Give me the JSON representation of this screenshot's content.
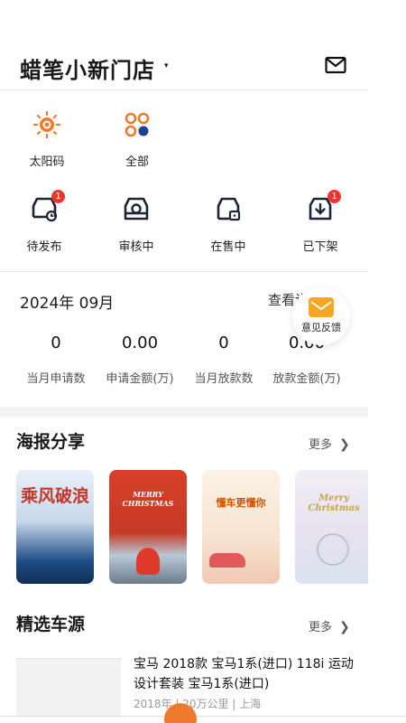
{
  "header": {
    "store_name": "蜡笔小新门店",
    "caret": "▾"
  },
  "quick_actions": [
    {
      "label": "太阳码",
      "icon": "sun-code-icon"
    },
    {
      "label": "全部",
      "icon": "grid-all-icon"
    }
  ],
  "status_items": [
    {
      "label": "待发布",
      "icon": "car-pending-icon",
      "badge": "1"
    },
    {
      "label": "审核中",
      "icon": "car-review-icon",
      "badge": ""
    },
    {
      "label": "在售中",
      "icon": "car-onsale-icon",
      "badge": ""
    },
    {
      "label": "已下架",
      "icon": "car-offshelf-icon",
      "badge": "1"
    }
  ],
  "stats": {
    "month": "2024年 09月",
    "view_more": "查看详",
    "items": [
      {
        "value": "0",
        "caption": "当月申请数"
      },
      {
        "value": "0.00",
        "caption": "申请金额(万)"
      },
      {
        "value": "0",
        "caption": "当月放款数"
      },
      {
        "value": "0.00",
        "caption": "放款金额(万)"
      }
    ]
  },
  "feedback": {
    "label": "意见反馈"
  },
  "posters_section": {
    "title": "海报分享",
    "more": "更多",
    "posters": [
      {
        "text": "乘风破浪"
      },
      {
        "text": "MERRY CHRISTMAS"
      },
      {
        "text": "懂车更懂你"
      },
      {
        "text": "Merry Christmas"
      }
    ]
  },
  "cars_section": {
    "title": "精选车源",
    "more": "更多",
    "car": {
      "title": "宝马 2018款 宝马1系(进口) 118i 运动设计套装 宝马1系(进口)",
      "meta": "2018年 | 20万公里 | 上海"
    }
  },
  "colors": {
    "accent": "#f07a2c",
    "badge": "#e8382c",
    "feedback": "#f5a623"
  }
}
